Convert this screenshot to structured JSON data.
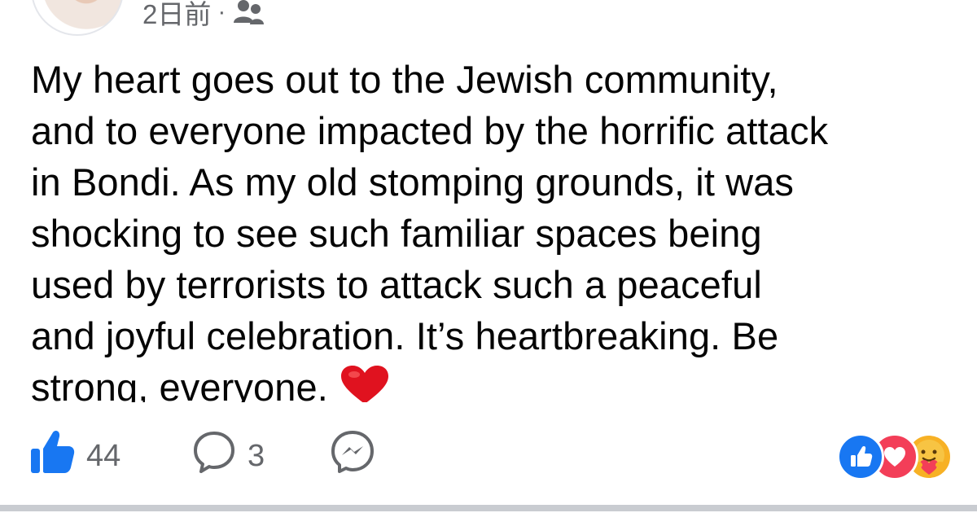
{
  "post": {
    "meta": {
      "time": "2日前",
      "separator": "·",
      "audience_icon": "friends-icon"
    },
    "text": "My heart goes out to the Jewish community,\nand to everyone impacted by the horrific attack\nin Bondi. As my old stomping grounds, it was\nshocking to see such familiar spaces being\nused by terrorists to attack such a peaceful\nand joyful celebration. It’s heartbreaking. Be\nstrong, everyone.",
    "emoji": "red-heart-emoji"
  },
  "actions": {
    "like_count": "44",
    "comment_count": "3",
    "like_icon": "thumbs-up-icon",
    "comment_icon": "comment-bubble-icon",
    "share_icon": "messenger-icon"
  },
  "reactions": [
    "like",
    "love",
    "care"
  ],
  "colors": {
    "text": "#050505",
    "secondary": "#65676b",
    "brand_blue": "#1877f2",
    "love_red": "#f33e58",
    "care_yellow": "#f7b125",
    "heart_red": "#e0121f",
    "divider": "#c9ccd1"
  }
}
